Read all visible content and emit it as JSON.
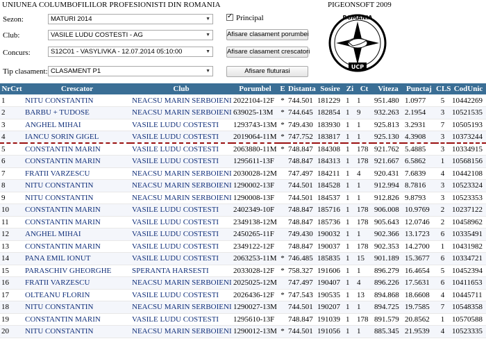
{
  "header": {
    "org_title": "UNIUNEA COLUMBOFILILOR PROFESIONISTI DIN ROMANIA",
    "brand": "PIGEONSOFT 2009"
  },
  "form": {
    "sezon": {
      "label": "Sezon:",
      "value": "MATURI 2014"
    },
    "club": {
      "label": "Club:",
      "value": "VASILE LUDU COSTESTI - AG"
    },
    "concurs": {
      "label": "Concurs:",
      "value": "S12C01 - VASYLIVKA - 12.07.2014 05:10:00"
    },
    "tip": {
      "label": "Tip clasament:",
      "value": "CLASAMENT P1"
    },
    "principal": {
      "label": "Principal",
      "checked": true
    }
  },
  "buttons": {
    "porumbei": "Afisare clasament porumbei",
    "crescatori": "Afisare clasament crescatori",
    "fluturasi": "Afisare fluturasi"
  },
  "logo": {
    "top_text": "ROMÂNIA",
    "bottom_text": "UCP"
  },
  "table": {
    "columns": [
      "NrCrt",
      "Crescator",
      "Club",
      "Porumbel",
      "E",
      "Distanta",
      "Sosire",
      "Zi",
      "Ct",
      "Viteza",
      "Punctaj",
      "CLS",
      "CodUnic"
    ],
    "rows": [
      [
        "1",
        "NITU CONSTANTIN",
        "NEACSU MARIN SERBOIENI",
        "2022104-12F",
        "*",
        "744.501",
        "181229",
        "1",
        "1",
        "951.480",
        "1.0977",
        "5",
        "10442269"
      ],
      [
        "2",
        "BARBU + TUDOSE",
        "NEACSU MARIN SERBOIENI",
        "639025-13M",
        "*",
        "744.645",
        "182854",
        "1",
        "9",
        "932.263",
        "2.1954",
        "3",
        "10521535"
      ],
      [
        "3",
        "ANGHEL MIHAI",
        "VASILE LUDU COSTESTI",
        "1293743-13M",
        "*",
        "749.430",
        "183930",
        "1",
        "1",
        "925.813",
        "3.2931",
        "7",
        "10505193"
      ],
      [
        "4",
        "IANCU SORIN GIGEL",
        "VASILE LUDU COSTESTI",
        "2019064-11M",
        "*",
        "747.752",
        "183817",
        "1",
        "1",
        "925.130",
        "4.3908",
        "3",
        "10373244"
      ],
      [
        "5",
        "CONSTANTIN MARIN",
        "VASILE LUDU COSTESTI",
        "2063880-11M",
        "*",
        "748.847",
        "184308",
        "1",
        "178",
        "921.762",
        "5.4885",
        "3",
        "10334915"
      ],
      [
        "6",
        "CONSTANTIN MARIN",
        "VASILE LUDU COSTESTI",
        "1295611-13F",
        "",
        "748.847",
        "184313",
        "1",
        "178",
        "921.667",
        "6.5862",
        "1",
        "10568156"
      ],
      [
        "7",
        "FRATII VARZESCU",
        "NEACSU MARIN SERBOIENI",
        "2030028-12M",
        "",
        "747.497",
        "184211",
        "1",
        "4",
        "920.431",
        "7.6839",
        "4",
        "10442108"
      ],
      [
        "8",
        "NITU CONSTANTIN",
        "NEACSU MARIN SERBOIENI",
        "1290002-13F",
        "",
        "744.501",
        "184528",
        "1",
        "1",
        "912.994",
        "8.7816",
        "3",
        "10523324"
      ],
      [
        "9",
        "NITU CONSTANTIN",
        "NEACSU MARIN SERBOIENI",
        "1290008-13F",
        "",
        "744.501",
        "184537",
        "1",
        "1",
        "912.826",
        "9.8793",
        "3",
        "10523353"
      ],
      [
        "10",
        "CONSTANTIN MARIN",
        "VASILE LUDU COSTESTI",
        "2402349-10F",
        "",
        "748.847",
        "185716",
        "1",
        "178",
        "906.008",
        "10.9769",
        "2",
        "10237122"
      ],
      [
        "11",
        "CONSTANTIN MARIN",
        "VASILE LUDU COSTESTI",
        "2349138-12M",
        "",
        "748.847",
        "185736",
        "1",
        "178",
        "905.643",
        "12.0746",
        "2",
        "10458962"
      ],
      [
        "12",
        "ANGHEL MIHAI",
        "VASILE LUDU COSTESTI",
        "2450265-11F",
        "",
        "749.430",
        "190032",
        "1",
        "1",
        "902.366",
        "13.1723",
        "6",
        "10335491"
      ],
      [
        "13",
        "CONSTANTIN MARIN",
        "VASILE LUDU COSTESTI",
        "2349122-12F",
        "",
        "748.847",
        "190037",
        "1",
        "178",
        "902.353",
        "14.2700",
        "1",
        "10431982"
      ],
      [
        "14",
        "PANA EMIL IONUT",
        "VASILE LUDU COSTESTI",
        "2063253-11M",
        "*",
        "746.485",
        "185835",
        "1",
        "15",
        "901.189",
        "15.3677",
        "6",
        "10334721"
      ],
      [
        "15",
        "PARASCHIV GHEORGHE",
        "SPERANTA HARSESTI",
        "2033028-12F",
        "*",
        "758.327",
        "191606",
        "1",
        "1",
        "896.279",
        "16.4654",
        "5",
        "10452394"
      ],
      [
        "16",
        "FRATII VARZESCU",
        "NEACSU MARIN SERBOIENI",
        "2025025-12M",
        "",
        "747.497",
        "190407",
        "1",
        "4",
        "896.226",
        "17.5631",
        "6",
        "10411653"
      ],
      [
        "17",
        "OLTEANU FLORIN",
        "VASILE LUDU COSTESTI",
        "2026436-12F",
        "*",
        "747.543",
        "190535",
        "1",
        "13",
        "894.868",
        "18.6608",
        "4",
        "10445711"
      ],
      [
        "18",
        "NITU CONSTANTIN",
        "NEACSU MARIN SERBOIENI",
        "1290027-13M",
        "",
        "744.501",
        "190207",
        "1",
        "1",
        "894.725",
        "19.7585",
        "7",
        "10548358"
      ],
      [
        "19",
        "CONSTANTIN MARIN",
        "VASILE LUDU COSTESTI",
        "1295610-13F",
        "",
        "748.847",
        "191039",
        "1",
        "178",
        "891.579",
        "20.8562",
        "1",
        "10570588"
      ],
      [
        "20",
        "NITU CONSTANTIN",
        "NEACSU MARIN SERBOIENI",
        "1290012-13M",
        "*",
        "744.501",
        "191056",
        "1",
        "1",
        "885.345",
        "21.9539",
        "4",
        "10523335"
      ]
    ]
  }
}
